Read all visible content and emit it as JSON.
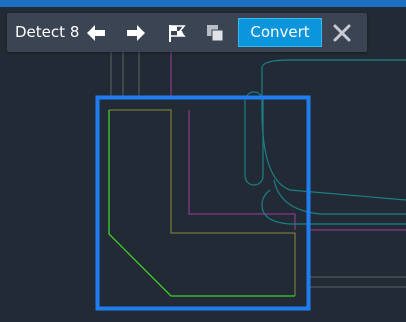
{
  "toolbar": {
    "detect_label": "Detect",
    "detect_count": "8",
    "convert_label": "Convert",
    "icons": {
      "previous": "arrow-left-icon",
      "next": "arrow-right-icon",
      "flag": "flag-icon",
      "copy": "copy-icon",
      "close": "close-icon"
    }
  },
  "colors": {
    "canvas_background": "#222b35",
    "toolbar_background": "#3b4452",
    "accent": "#0a95dc",
    "selection_box": "#1e7ef0",
    "detected_outline": "#3ecf2a",
    "olive_lines": "#8c8a32",
    "magenta_lines": "#a23a9e",
    "teal_shapes": "#1c7f86",
    "grey_lines": "#5a6068"
  }
}
